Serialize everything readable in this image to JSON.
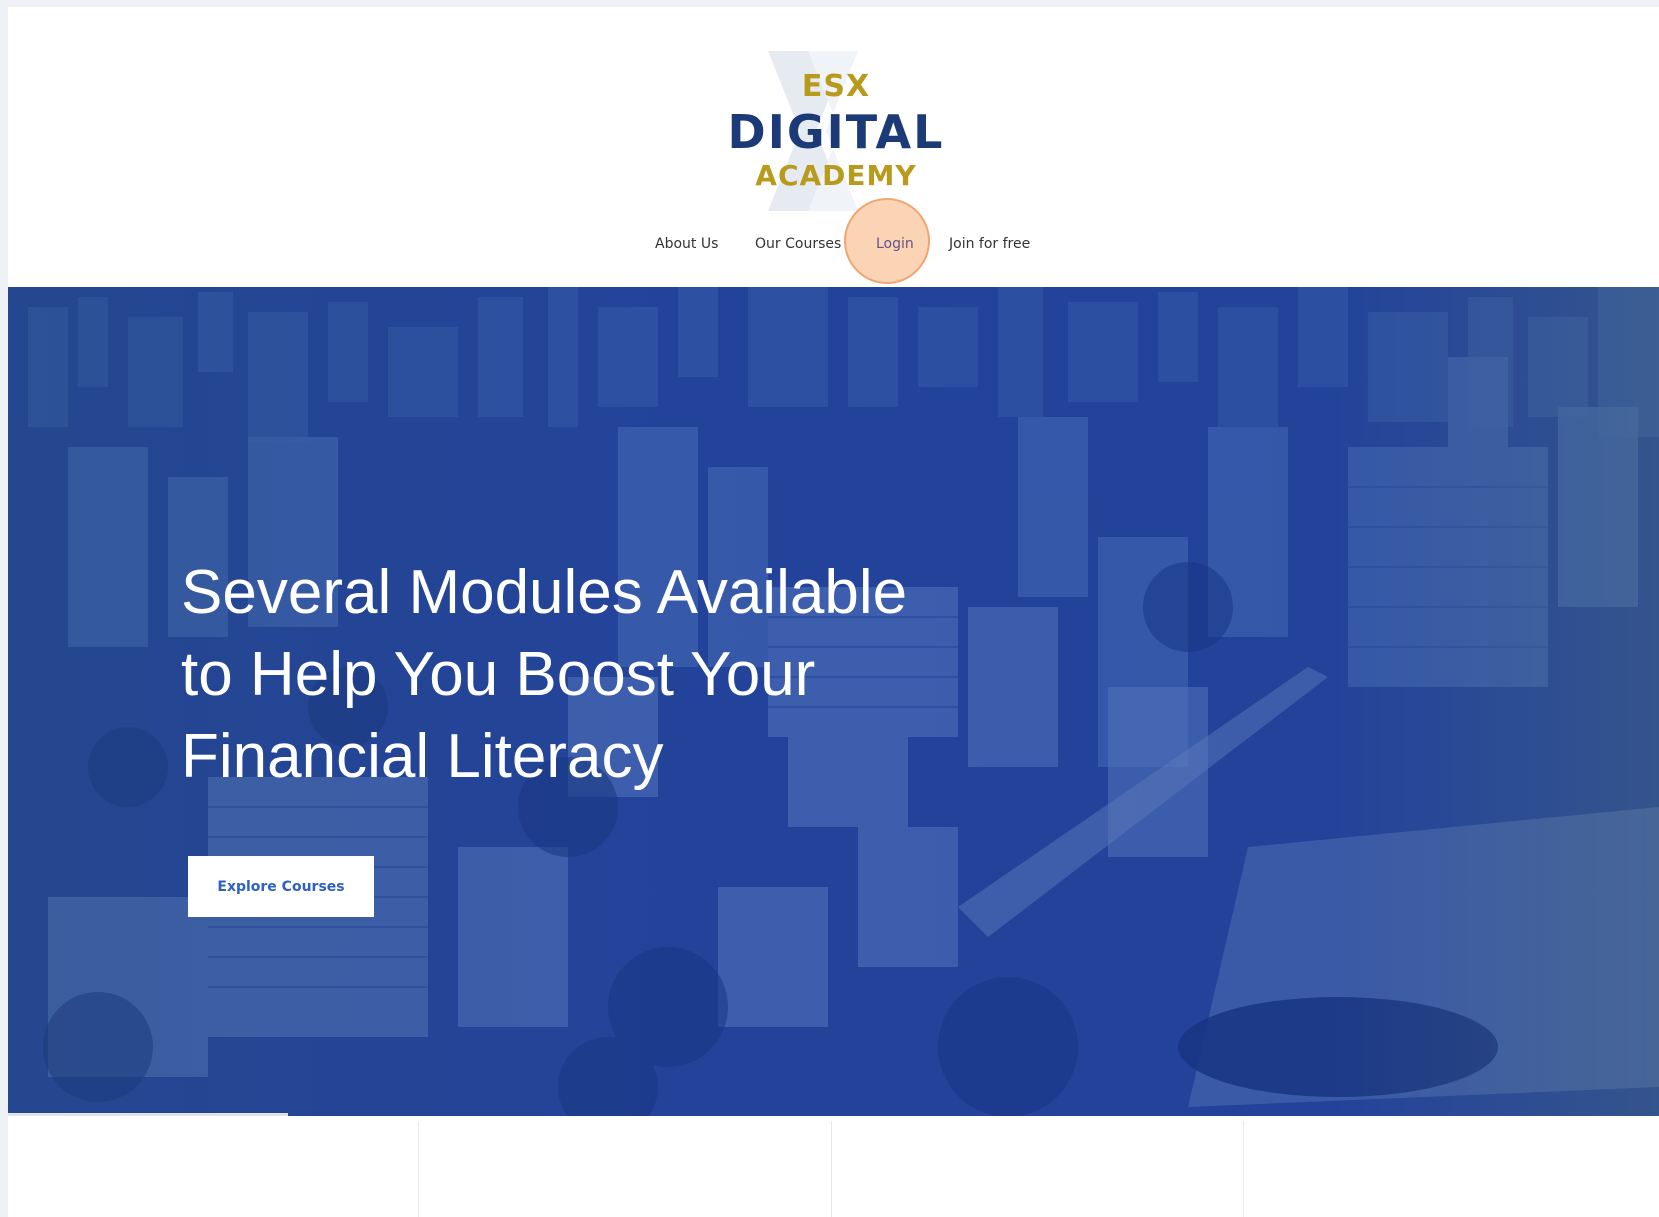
{
  "brand": {
    "logo_line1": "ESX",
    "logo_line2": "DIGITAL",
    "logo_line3": "ACADEMY",
    "colors": {
      "navy": "#1d3a78",
      "gold": "#b89a1c",
      "hero_blue": "#1f3f96"
    }
  },
  "nav": {
    "items": [
      {
        "label": "About Us"
      },
      {
        "label": "Our Courses"
      },
      {
        "label": "Login"
      },
      {
        "label": "Join for free"
      }
    ]
  },
  "hero": {
    "title_lines": [
      "Several Modules Available",
      "to Help You Boost Your",
      "Financial Literacy"
    ],
    "cta_label": "Explore Courses",
    "background": "city-skyline-photo"
  }
}
